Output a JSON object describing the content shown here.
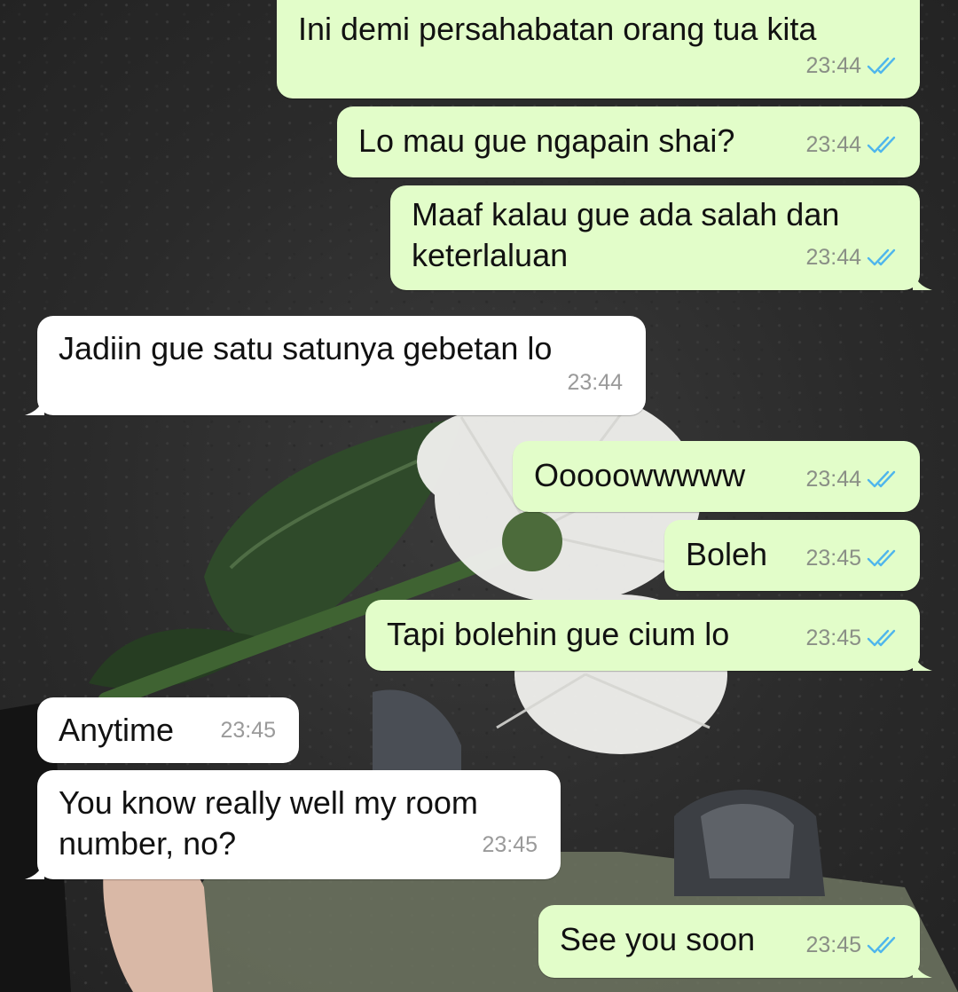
{
  "chat": {
    "messages": [
      {
        "direction": "out",
        "text": "Ini demi persahabatan orang tua kita",
        "time": "23:44",
        "status": "read-ticks-icon"
      },
      {
        "direction": "out",
        "text": "Lo mau gue ngapain shai?",
        "time": "23:44",
        "status": "read-ticks-icon"
      },
      {
        "direction": "out",
        "text": "Maaf kalau gue ada salah dan keterlaluan",
        "time": "23:44",
        "status": "read-ticks-icon"
      },
      {
        "direction": "in",
        "text": "Jadiin gue satu satunya gebetan lo",
        "time": "23:44"
      },
      {
        "direction": "out",
        "text": "Ooooowwwww",
        "time": "23:44",
        "status": "read-ticks-icon"
      },
      {
        "direction": "out",
        "text": "Boleh",
        "time": "23:45",
        "status": "read-ticks-icon"
      },
      {
        "direction": "out",
        "text": "Tapi bolehin gue cium lo",
        "time": "23:45",
        "status": "read-ticks-icon"
      },
      {
        "direction": "in",
        "text": "Anytime",
        "time": "23:45"
      },
      {
        "direction": "in",
        "text": "You know really well my room number, no?",
        "time": "23:45"
      },
      {
        "direction": "out",
        "text": "See you soon",
        "time": "23:45",
        "status": "read-ticks-icon"
      }
    ]
  },
  "colors": {
    "outgoing_bubble": "#e2fdc9",
    "incoming_bubble": "#ffffff",
    "read_ticks": "#4fb6ec",
    "timestamp": "#8a8f86"
  }
}
